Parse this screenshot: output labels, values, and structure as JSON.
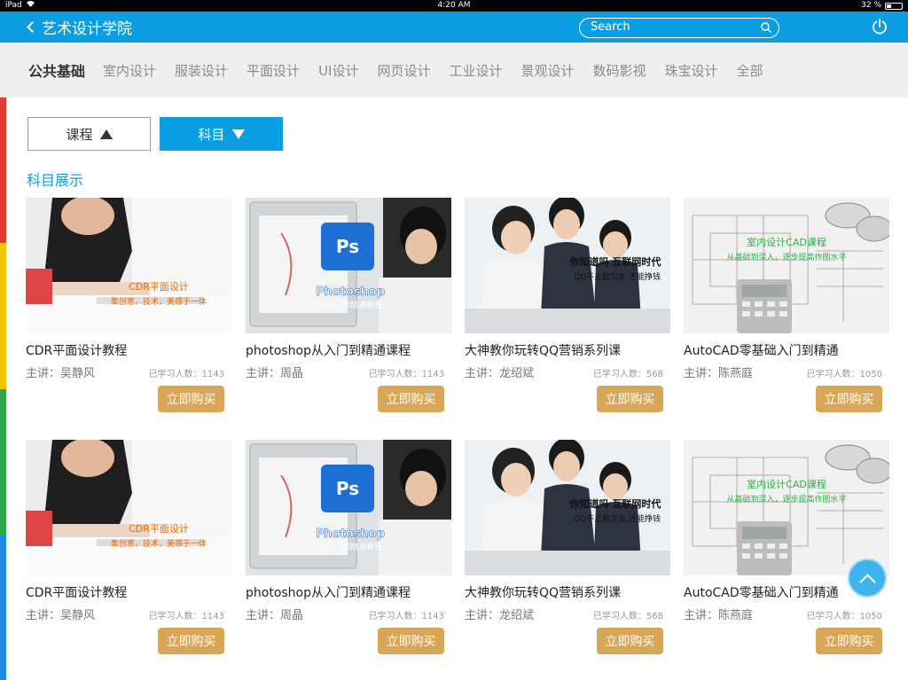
{
  "status_bar": {
    "device": "iPad",
    "time": "4:20 AM",
    "battery": "32 %"
  },
  "header": {
    "title": "艺术设计学院",
    "search_placeholder": "Search"
  },
  "categories": [
    {
      "label": "公共基础",
      "active": true
    },
    {
      "label": "室内设计"
    },
    {
      "label": "服装设计"
    },
    {
      "label": "平面设计"
    },
    {
      "label": "UI设计"
    },
    {
      "label": "网页设计"
    },
    {
      "label": "工业设计"
    },
    {
      "label": "景观设计"
    },
    {
      "label": "数码影视"
    },
    {
      "label": "珠宝设计"
    },
    {
      "label": "全部"
    }
  ],
  "toggles": {
    "course": "课程",
    "subject": "科目"
  },
  "section_title": "科目展示",
  "buy_label": "立即购买",
  "courses": [
    {
      "title": "CDR平面设计教程",
      "teacher": "主讲：吴静风",
      "learners": "已学习人数：1143",
      "image_text": [
        "CDR平面设计",
        "集创意，技术，美感于一体"
      ]
    },
    {
      "title": "photoshop从入门到精通课程",
      "teacher": "主讲：周晶",
      "learners": "已学习人数：1143",
      "image_text": [
        "Ps",
        "Photoshop",
        "从入门到精通教程"
      ]
    },
    {
      "title": "大神教你玩转QQ营销系列课",
      "teacher": "主讲：龙绍斌",
      "learners": "已学习人数：568",
      "image_text": [
        "你知道吗 互联网时代",
        "QQ不止能交友 还能挣钱"
      ]
    },
    {
      "title": "AutoCAD零基础入门到精通",
      "teacher": "主讲：陈燕庭",
      "learners": "已学习人数：1050",
      "image_text": [
        "室内设计CAD课程",
        "从基础到深入，逐步提高作图水平"
      ]
    }
  ],
  "colors": {
    "brand_blue": "#0b9ee3",
    "buy_gold": "#d8a657",
    "strip": [
      "#e53935",
      "#f2c500",
      "#2ea84a",
      "#1e88e5"
    ]
  }
}
